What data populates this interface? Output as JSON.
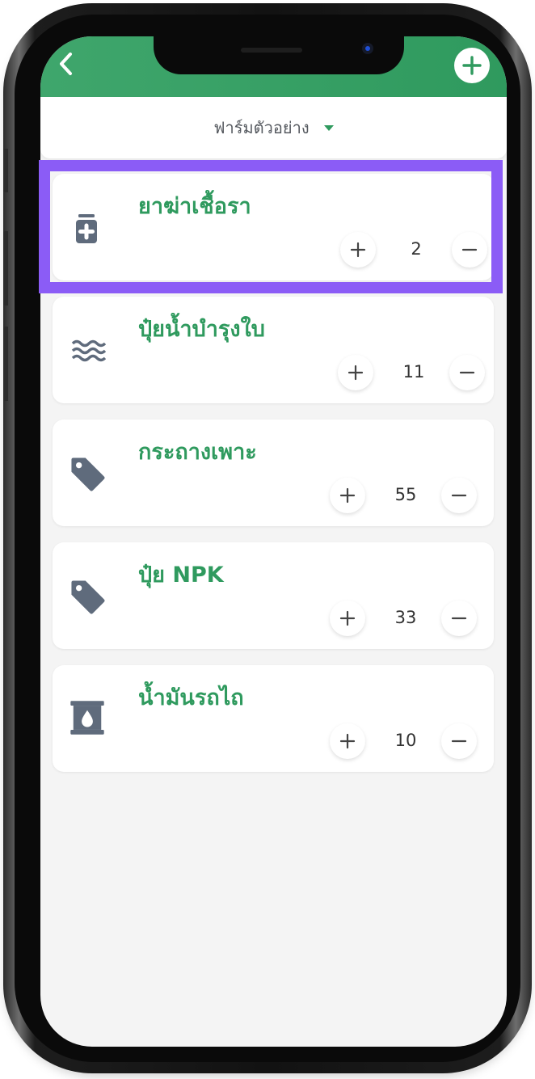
{
  "header": {
    "title": "",
    "back_icon": "chevron-left-icon",
    "add_icon": "plus-circle-icon"
  },
  "farm_selector": {
    "label": "ฟาร์มตัวอย่าง",
    "icon": "caret-down-icon"
  },
  "items": [
    {
      "name": "ยาฆ่าเชื้อรา",
      "icon": "medicine-bottle-icon",
      "quantity": "2"
    },
    {
      "name": "ปุ๋ยน้ำบำรุงใบ",
      "icon": "water-waves-icon",
      "quantity": "11"
    },
    {
      "name": "กระถางเพาะ",
      "icon": "tag-icon",
      "quantity": "55"
    },
    {
      "name": "ปุ๋ย NPK",
      "icon": "tag-icon",
      "quantity": "33"
    },
    {
      "name": "น้ำมันรถไถ",
      "icon": "oil-drum-icon",
      "quantity": "10"
    }
  ],
  "colors": {
    "accent_green": "#2f9a5e",
    "icon_gray": "#5f6b7c",
    "highlight": "#8b5cf6"
  }
}
